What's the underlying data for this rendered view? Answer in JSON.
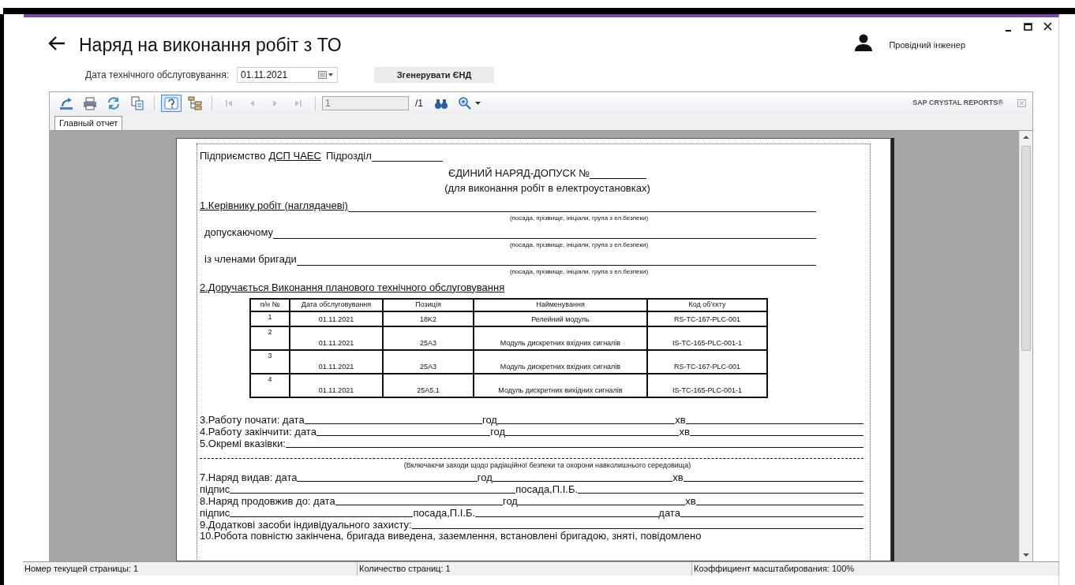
{
  "window": {
    "title": "Наряд на виконання робіт з ТО",
    "user": "Провідний інженер"
  },
  "filter": {
    "label": "Дата технічного обслуговування:",
    "date": "01.11.2021",
    "button": "Згенерувати ЄНД"
  },
  "toolbar": {
    "tools": [
      {
        "kind": "export",
        "disabled": false,
        "on": false
      },
      {
        "kind": "print",
        "disabled": false,
        "on": false
      },
      {
        "kind": "refresh",
        "disabled": false,
        "on": false
      },
      {
        "kind": "copy",
        "disabled": false,
        "on": false
      },
      {
        "kind": "sep"
      },
      {
        "kind": "help",
        "disabled": false,
        "on": true
      },
      {
        "kind": "tree",
        "disabled": false,
        "on": false
      },
      {
        "kind": "sep"
      },
      {
        "kind": "first",
        "disabled": true,
        "on": false
      },
      {
        "kind": "prev",
        "disabled": true,
        "on": false
      },
      {
        "kind": "next",
        "disabled": true,
        "on": false
      },
      {
        "kind": "last",
        "disabled": true,
        "on": false
      },
      {
        "kind": "sep"
      },
      {
        "kind": "page"
      },
      {
        "kind": "find",
        "disabled": false,
        "on": false
      },
      {
        "kind": "zoom",
        "disabled": false,
        "on": false
      }
    ],
    "page_value": "1",
    "page_total": "/1",
    "brand": "SAP CRYSTAL REPORTS®"
  },
  "tabs": [
    {
      "label": "Главный отчет",
      "selected": true
    }
  ],
  "document": {
    "enterprise_label": "Підприємство",
    "enterprise": "ДСП ЧАЕС",
    "division_label": "Підрозділ",
    "title": "ЄДИНИЙ НАРЯД-ДОПУСК  №",
    "subtitle": "(для виконання робіт в електроустановках)",
    "upper": [
      {
        "kind": "fields",
        "labels": [
          "1.Керівнику робіт (наглядачеві)"
        ],
        "underlined": true
      },
      {
        "kind": "hint",
        "text": "(посада, прізвище, ініціали, група з ел.безпеки)"
      },
      {
        "kind": "fields",
        "labels": [
          "допускаючому"
        ],
        "underlined": false
      },
      {
        "kind": "hint",
        "text": "(посада, прізвище, ініціали, група з ел.безпеки)"
      },
      {
        "kind": "fields",
        "labels": [
          "із членами бригади"
        ],
        "underlined": false
      },
      {
        "kind": "hint",
        "text": "(посада, прізвище, ініціали, група з ел.безпеки)"
      },
      {
        "kind": "heading",
        "text": "2.Доручається Виконання планового технічного обслуговування"
      }
    ],
    "table": {
      "columns": [
        "п/н №",
        "Дата обслуговування",
        "Позиція",
        "Найменування",
        "Код об'єкту"
      ],
      "rows": [
        [
          "1",
          "01.11.2021",
          "18K2",
          "Релейний модуль",
          "RS-TC-167-PLC-001"
        ],
        [
          "2",
          "01.11.2021",
          "25A3",
          "Модуль дискретних вхідних сигналів",
          "IS-TC-165-PLC-001-1"
        ],
        [
          "3",
          "01.11.2021",
          "25A3",
          "Модуль дискретних вхідних сигналів",
          "RS-TC-167-PLC-001"
        ],
        [
          "4",
          "01.11.2021",
          "25A5.1",
          "Модуль дискретних вихідних сигналів",
          "IS-TC-165-PLC-001-1"
        ]
      ]
    },
    "lower": [
      {
        "kind": "fields",
        "labels": [
          "3.Работу почати: дата",
          "год",
          "хв"
        ],
        "underlined": false
      },
      {
        "kind": "fields",
        "labels": [
          "4.Работу закінчити: дата",
          "год",
          "хв"
        ],
        "underlined": false
      },
      {
        "kind": "fields",
        "labels": [
          "5.Окремі вказівки:"
        ],
        "underlined": false
      },
      {
        "kind": "blank"
      },
      {
        "kind": "hint",
        "text": "(Включаючи заходи щодо радіаційної безпеки та охорони навколишнього середовища)"
      },
      {
        "kind": "fields",
        "labels": [
          "7.Наряд видав: дата",
          "год",
          "хв"
        ],
        "underlined": false
      },
      {
        "kind": "fields",
        "labels": [
          "підпис",
          "посада,П.І.Б."
        ],
        "underlined": false
      },
      {
        "kind": "fields",
        "labels": [
          "8.Наряд продовжив до: дата",
          "год",
          "хв"
        ],
        "underlined": false
      },
      {
        "kind": "fields",
        "labels": [
          "підпис",
          "посада,П.І.Б.",
          "дата"
        ],
        "underlined": false
      },
      {
        "kind": "fields",
        "labels": [
          "9.Додаткові засоби індивідуального захисту:"
        ],
        "underlined": false
      },
      {
        "kind": "text",
        "text": "10.Робота повністю закінчена, бригада виведена, заземлення, встановлені бригадою, зняті, повідомлено"
      }
    ]
  },
  "status_bar": [
    "Номер текущей страницы: 1",
    "Количество страниц: 1",
    "Коэффициент масштабирования: 100%"
  ]
}
